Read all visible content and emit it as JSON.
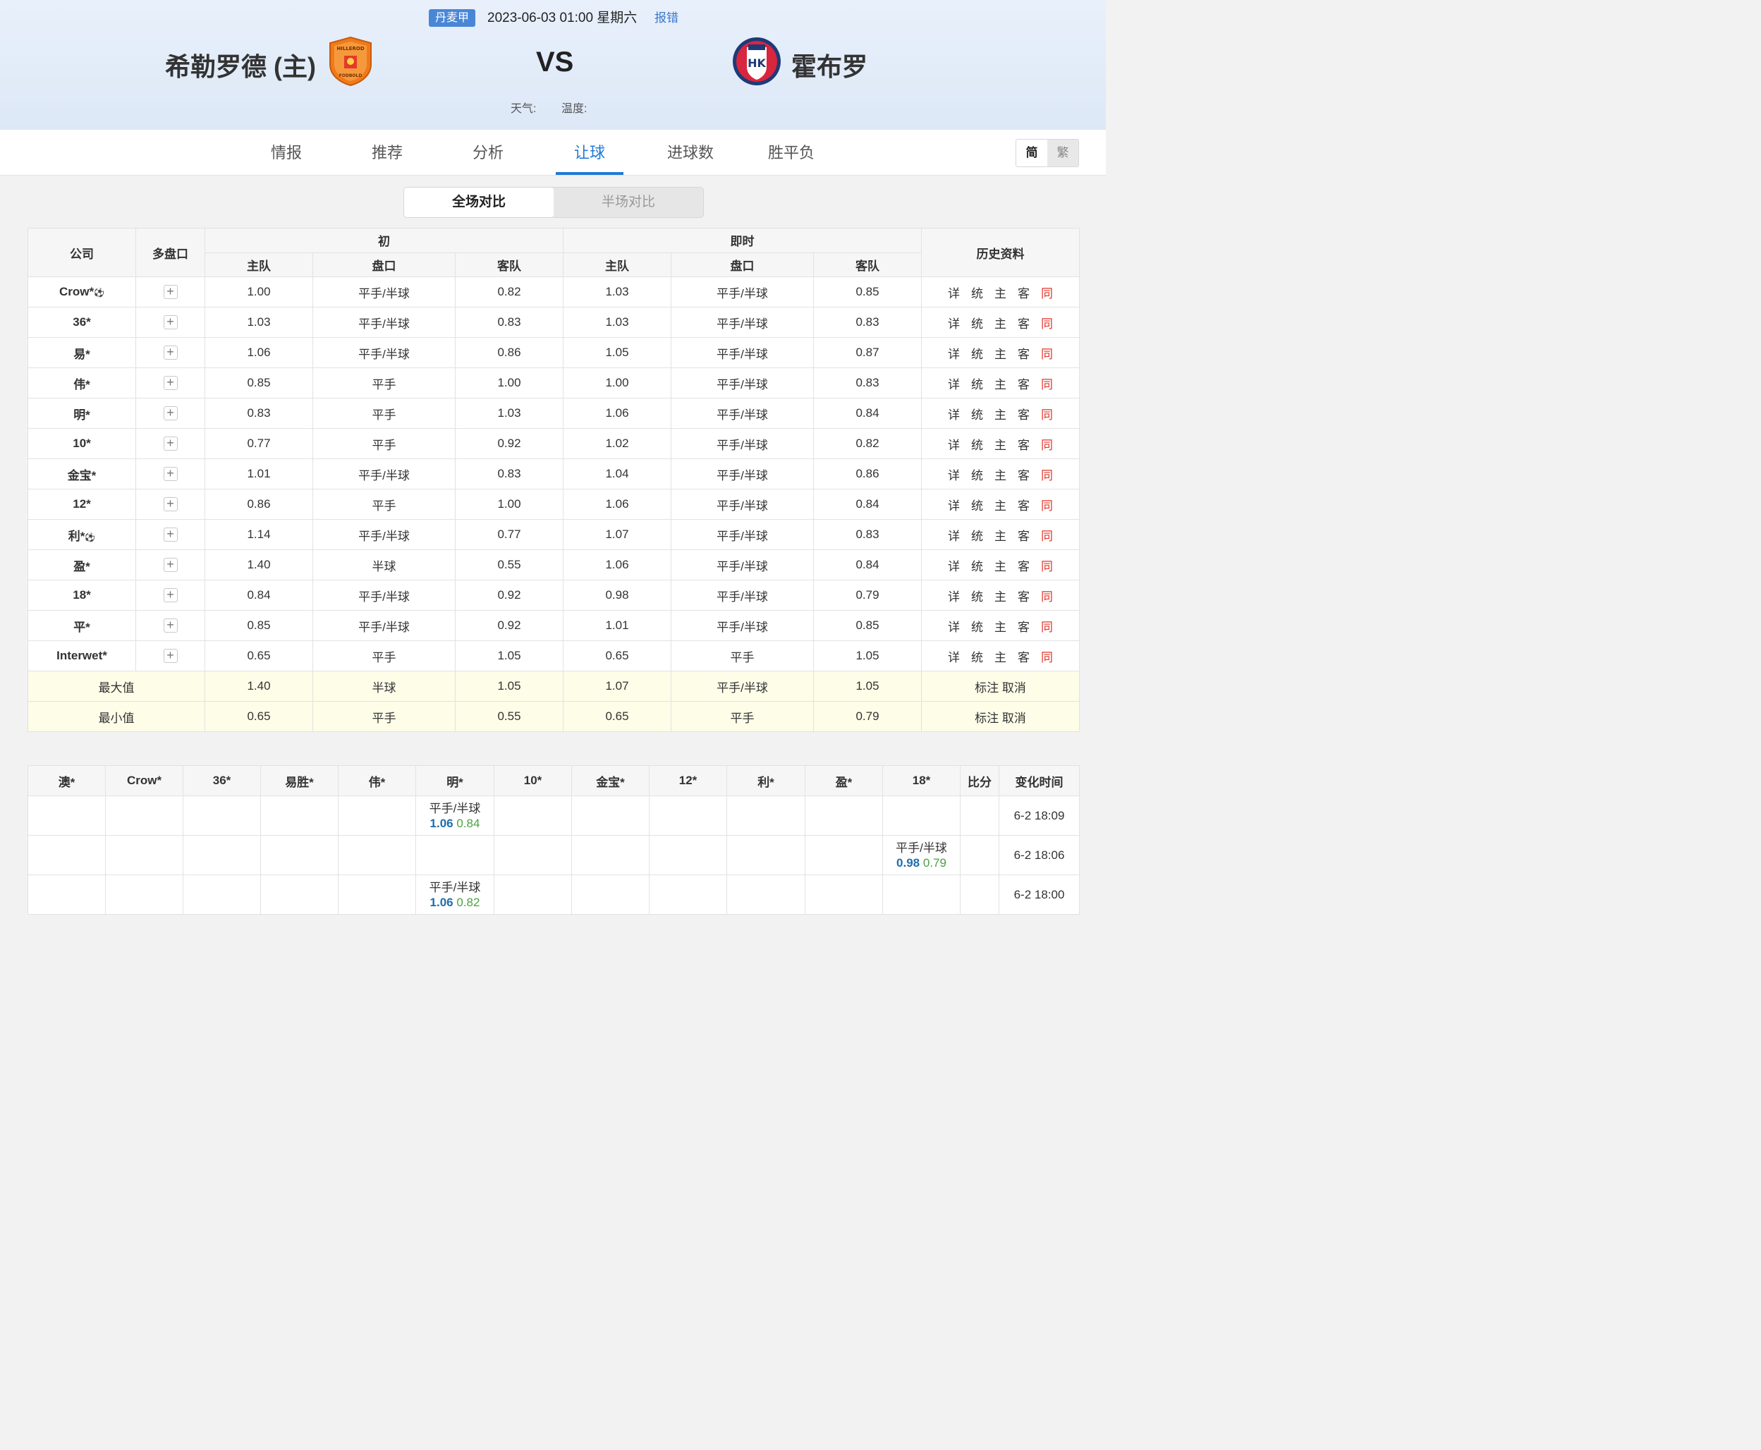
{
  "header": {
    "league": "丹麦甲",
    "datetime": "2023-06-03 01:00 星期六",
    "report": "报错",
    "home_team": "希勒罗德 (主)",
    "away_team": "霍布罗",
    "vs": "VS",
    "weather_label": "天气:",
    "temp_label": "温度:",
    "home_logo_text_top": "HILLEROD",
    "home_logo_text_bottom": "FODBOLD",
    "away_logo_text": "HK"
  },
  "tabs": [
    "情报",
    "推荐",
    "分析",
    "让球",
    "进球数",
    "胜平负"
  ],
  "active_tab": "让球",
  "lang": {
    "simplified": "简",
    "traditional": "繁"
  },
  "segment": {
    "full": "全场对比",
    "half": "半场对比"
  },
  "odds_table": {
    "headers": {
      "company": "公司",
      "multi": "多盘口",
      "initial": "初",
      "live": "即时",
      "history": "历史资料",
      "home": "主队",
      "line": "盘口",
      "away": "客队"
    },
    "history_links": [
      "详",
      "统",
      "主",
      "客",
      "同"
    ],
    "rows": [
      {
        "company": "Crow*",
        "ball": true,
        "ih": "1.00",
        "il": "平手/半球",
        "ia": "0.82",
        "lh": "1.03",
        "ll": "平手/半球",
        "la": "0.85"
      },
      {
        "company": "36*",
        "ball": false,
        "ih": "1.03",
        "il": "平手/半球",
        "ia": "0.83",
        "lh": "1.03",
        "ll": "平手/半球",
        "la": "0.83"
      },
      {
        "company": "易*",
        "ball": false,
        "ih": "1.06",
        "il": "平手/半球",
        "ia": "0.86",
        "lh": "1.05",
        "ll": "平手/半球",
        "la": "0.87"
      },
      {
        "company": "伟*",
        "ball": false,
        "ih": "0.85",
        "il": "平手",
        "ia": "1.00",
        "lh": "1.00",
        "ll": "平手/半球",
        "la": "0.83"
      },
      {
        "company": "明*",
        "ball": false,
        "ih": "0.83",
        "il": "平手",
        "ia": "1.03",
        "lh": "1.06",
        "ll": "平手/半球",
        "la": "0.84"
      },
      {
        "company": "10*",
        "ball": false,
        "ih": "0.77",
        "il": "平手",
        "ia": "0.92",
        "lh": "1.02",
        "ll": "平手/半球",
        "la": "0.82"
      },
      {
        "company": "金宝*",
        "ball": false,
        "ih": "1.01",
        "il": "平手/半球",
        "ia": "0.83",
        "lh": "1.04",
        "ll": "平手/半球",
        "la": "0.86"
      },
      {
        "company": "12*",
        "ball": false,
        "ih": "0.86",
        "il": "平手",
        "ia": "1.00",
        "lh": "1.06",
        "ll": "平手/半球",
        "la": "0.84"
      },
      {
        "company": "利*",
        "ball": true,
        "ih": "1.14",
        "il": "平手/半球",
        "ia": "0.77",
        "lh": "1.07",
        "ll": "平手/半球",
        "la": "0.83"
      },
      {
        "company": "盈*",
        "ball": false,
        "ih": "1.40",
        "il": "半球",
        "ia": "0.55",
        "lh": "1.06",
        "ll": "平手/半球",
        "la": "0.84"
      },
      {
        "company": "18*",
        "ball": false,
        "ih": "0.84",
        "il": "平手/半球",
        "ia": "0.92",
        "lh": "0.98",
        "ll": "平手/半球",
        "la": "0.79"
      },
      {
        "company": "平*",
        "ball": false,
        "ih": "0.85",
        "il": "平手/半球",
        "ia": "0.92",
        "lh": "1.01",
        "ll": "平手/半球",
        "la": "0.85"
      },
      {
        "company": "Interwet*",
        "ball": false,
        "ih": "0.65",
        "il": "平手",
        "ia": "1.05",
        "lh": "0.65",
        "ll": "平手",
        "la": "1.05"
      }
    ],
    "max": {
      "label": "最大值",
      "ih": "1.40",
      "il": "半球",
      "ia": "1.05",
      "lh": "1.07",
      "ll": "平手/半球",
      "la": "1.05",
      "mark": "标注",
      "cancel": "取消"
    },
    "min": {
      "label": "最小值",
      "ih": "0.65",
      "il": "平手",
      "ia": "0.55",
      "lh": "0.65",
      "ll": "平手",
      "la": "0.79",
      "mark": "标注",
      "cancel": "取消"
    }
  },
  "change_table": {
    "headers": [
      "澳*",
      "Crow*",
      "36*",
      "易胜*",
      "伟*",
      "明*",
      "10*",
      "金宝*",
      "12*",
      "利*",
      "盈*",
      "18*",
      "比分",
      "变化时间"
    ],
    "rows": [
      {
        "col": 5,
        "line": "平手/半球",
        "v1": "1.06",
        "v2": "0.84",
        "time": "6-2 18:09"
      },
      {
        "col": 11,
        "line": "平手/半球",
        "v1": "0.98",
        "v2": "0.79",
        "time": "6-2 18:06"
      },
      {
        "col": 5,
        "line": "平手/半球",
        "v1": "1.06",
        "v2": "0.82",
        "time": "6-2 18:00"
      }
    ]
  }
}
